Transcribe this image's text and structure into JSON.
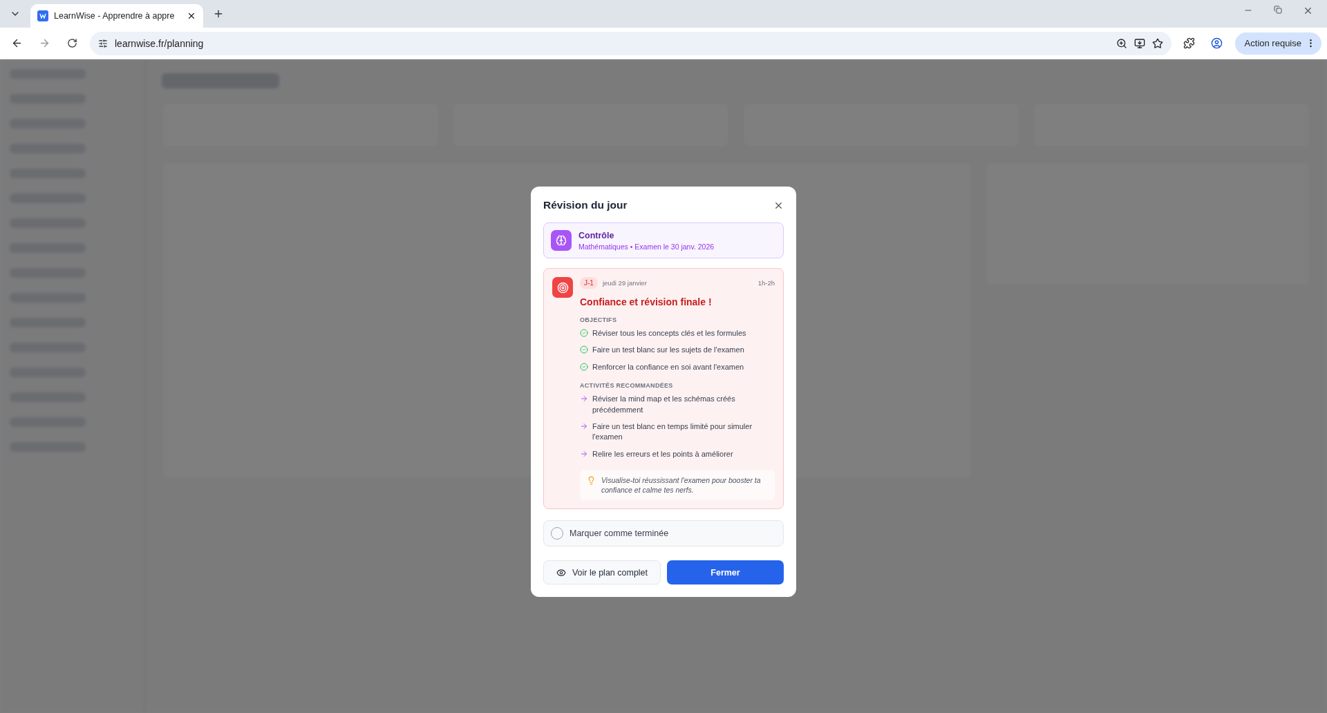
{
  "browser": {
    "tab_title": "LearnWise - Apprendre à appre",
    "url": "learnwise.fr/planning",
    "action_button": "Action requise"
  },
  "modal": {
    "title": "Révision du jour",
    "exam": {
      "name": "Contrôle",
      "details": "Mathématiques • Examen le 30 janv. 2026"
    },
    "session": {
      "badge": "J-1",
      "date": "jeudi 29 janvier",
      "duration": "1h-2h",
      "title": "Confiance et révision finale !",
      "objectives_heading": "OBJECTIFS",
      "objectives": [
        "Réviser tous les concepts clés et les formules",
        "Faire un test blanc sur les sujets de l'examen",
        "Renforcer la confiance en soi avant l'examen"
      ],
      "activities_heading": "ACTIVITÉS RECOMMANDÉES",
      "activities": [
        "Réviser la mind map et les schémas créés précédemment",
        "Faire un test blanc en temps limité pour simuler l'examen",
        "Relire les erreurs et les points à améliorer"
      ],
      "tip": "Visualise-toi réussissant l'examen pour booster ta confiance et calme tes nerfs."
    },
    "complete": {
      "label": "Marquer comme terminée",
      "checked": false
    },
    "buttons": [
      {
        "label": "Voir le plan complet",
        "kind": "secondary"
      },
      {
        "label": "Fermer",
        "kind": "primary"
      }
    ]
  }
}
